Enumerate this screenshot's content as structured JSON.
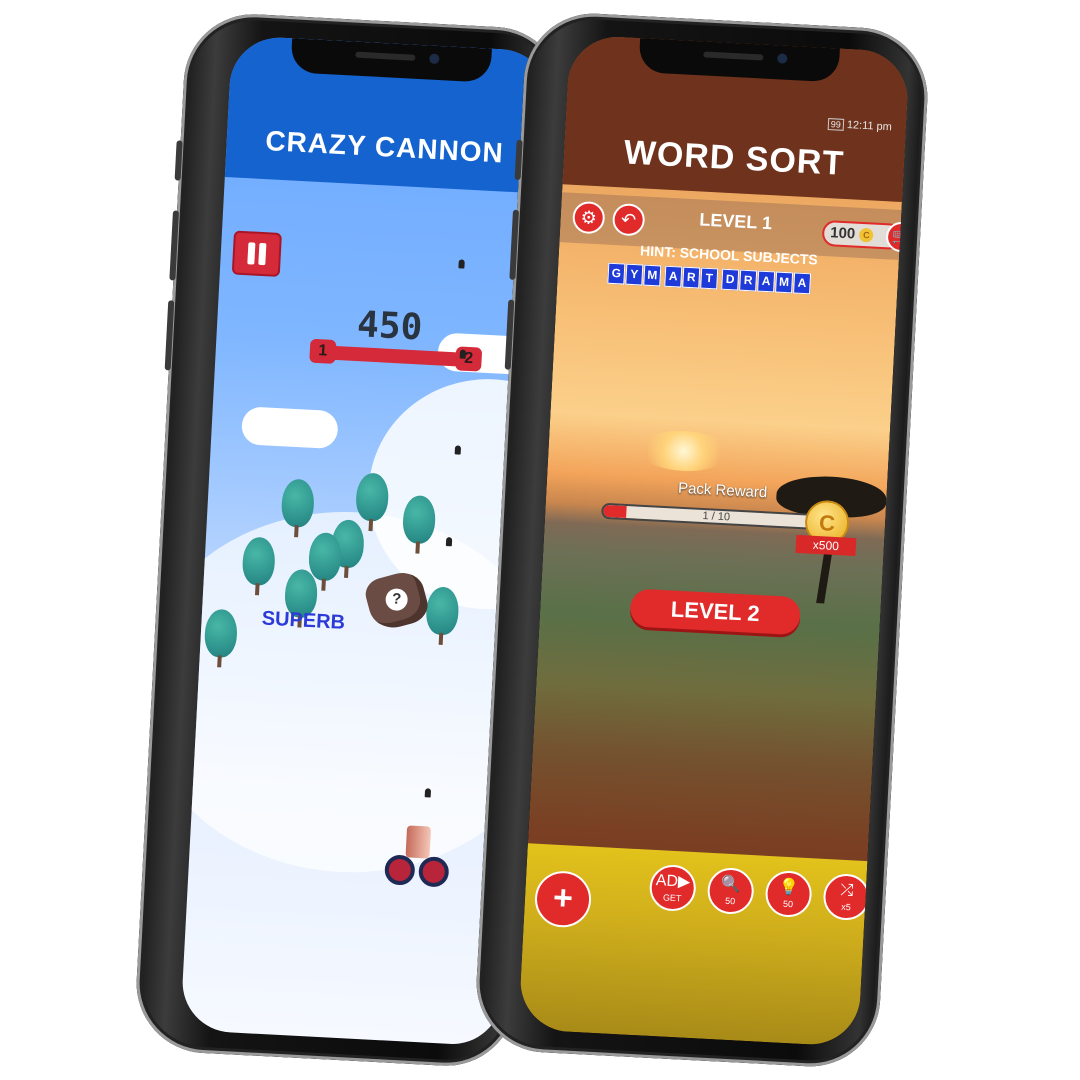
{
  "crazy_cannon": {
    "title": "CRAZY CANNON",
    "score": "450",
    "progress_start": "1",
    "progress_end": "2",
    "combo_text": "SUPERB",
    "mystery_symbol": "?"
  },
  "word_sort": {
    "title": "WORD SORT",
    "status_battery": "99",
    "status_time": "12:11 pm",
    "level_label": "LEVEL 1",
    "coins": "100",
    "hint": "HINT: SCHOOL SUBJECTS",
    "words": [
      "GYM",
      "ART",
      "DRAMA"
    ],
    "pack_reward_label": "Pack Reward",
    "pack_progress_text": "1 / 10",
    "pack_progress": 0.1,
    "reward_multiplier": "x500",
    "next_level_button": "LEVEL 2",
    "coin_symbol": "C",
    "tools": [
      {
        "name": "ad-get-coins",
        "icon": "AD▶",
        "label": "GET"
      },
      {
        "name": "magnifier",
        "icon": "🔍",
        "label": "50"
      },
      {
        "name": "lightbulb",
        "icon": "💡",
        "label": "50"
      },
      {
        "name": "shuffle",
        "icon": "⤮",
        "label": "x5"
      }
    ],
    "plus_label": "+"
  },
  "colors": {
    "cc_header": "#1563cf",
    "ws_header": "#6f321c",
    "accent_red": "#e12a2a",
    "tile_blue": "#1e3bd9",
    "bottom_yellow": "#e2c21b"
  }
}
